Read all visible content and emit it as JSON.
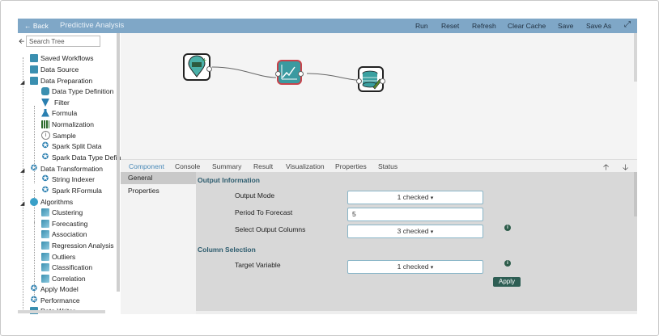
{
  "header": {
    "back_label": "Back",
    "title": "Predictive Analysis",
    "buttons": [
      "Run",
      "Reset",
      "Refresh",
      "Clear Cache",
      "Save",
      "Save As"
    ]
  },
  "sidebar": {
    "search_placeholder": "Search Tree",
    "items": [
      {
        "label": "Saved Workflows",
        "icon": "workflow-icon"
      },
      {
        "label": "Data Source",
        "icon": "data-source-icon"
      },
      {
        "label": "Data Preparation",
        "icon": "data-preparation-icon"
      },
      {
        "label": "Data Type Definition",
        "icon": "database-icon"
      },
      {
        "label": "Filter",
        "icon": "filter-icon"
      },
      {
        "label": "Formula",
        "icon": "flask-icon"
      },
      {
        "label": "Normalization",
        "icon": "bars-icon"
      },
      {
        "label": "Sample",
        "icon": "sample-icon"
      },
      {
        "label": "Spark Split Data",
        "icon": "spark-icon"
      },
      {
        "label": "Spark Data Type Defin",
        "icon": "spark-icon"
      },
      {
        "label": "Data Transformation",
        "icon": "spark-icon"
      },
      {
        "label": "String Indexer",
        "icon": "spark-icon"
      },
      {
        "label": "Spark RFormula",
        "icon": "spark-icon"
      },
      {
        "label": "Algorithms",
        "icon": "gear-icon"
      },
      {
        "label": "Clustering",
        "icon": "clustering-icon"
      },
      {
        "label": "Forecasting",
        "icon": "forecasting-icon"
      },
      {
        "label": "Association",
        "icon": "association-icon"
      },
      {
        "label": "Regression Analysis",
        "icon": "regression-icon"
      },
      {
        "label": "Outliers",
        "icon": "outliers-icon"
      },
      {
        "label": "Classification",
        "icon": "classification-icon"
      },
      {
        "label": "Correlation",
        "icon": "correlation-icon"
      },
      {
        "label": "Apply Model",
        "icon": "spark-icon"
      },
      {
        "label": "Performance",
        "icon": "spark-icon"
      },
      {
        "label": "Data Writer",
        "icon": "data-writer-icon"
      }
    ]
  },
  "tabs": [
    "Component",
    "Console",
    "Summary",
    "Result",
    "Visualization",
    "Properties",
    "Status"
  ],
  "subnav": [
    "General",
    "Properties"
  ],
  "form": {
    "output_section": "Output Information",
    "output_mode_label": "Output Mode",
    "output_mode_value": "1 checked",
    "period_label": "Period To Forecast",
    "period_value": "5",
    "select_columns_label": "Select Output Columns",
    "select_columns_value": "3 checked",
    "column_section": "Column Selection",
    "target_label": "Target Variable",
    "target_value": "1 checked",
    "apply_label": "Apply"
  },
  "colors": {
    "header_bg": "#7fa7c7",
    "active_tab": "#4a8ab8",
    "section_text": "#2d5c6e",
    "apply_bg": "#2e5e54",
    "selected_node_border": "#c9424a"
  }
}
